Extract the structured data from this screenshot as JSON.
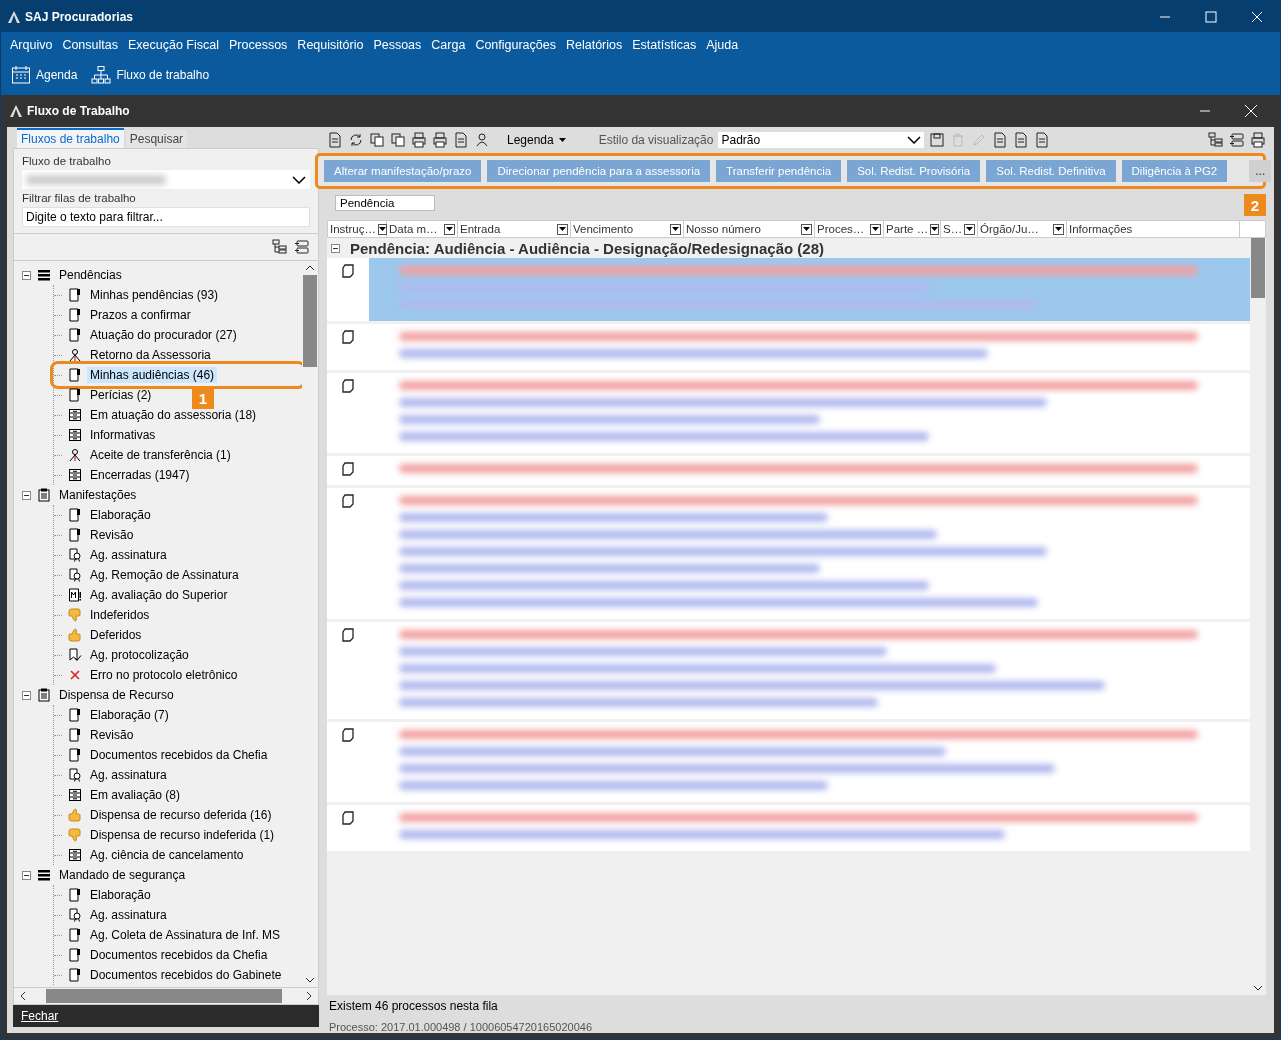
{
  "window": {
    "title": "SAJ Procuradorias"
  },
  "menu": [
    "Arquivo",
    "Consultas",
    "Execução Fiscal",
    "Processos",
    "Requisitório",
    "Pessoas",
    "Carga",
    "Configurações",
    "Relatórios",
    "Estatísticas",
    "Ajuda"
  ],
  "toolbar": [
    {
      "label": "Agenda",
      "kind": "calendar"
    },
    {
      "label": "Fluxo de trabalho",
      "kind": "hierarchy"
    }
  ],
  "inner_window": {
    "title": "Fluxo de Trabalho"
  },
  "left_tabs": [
    {
      "label": "Fluxos de trabalho",
      "selected": true
    },
    {
      "label": "Pesquisar",
      "selected": false
    }
  ],
  "workflow_field": {
    "label": "Fluxo de trabalho"
  },
  "filter_field": {
    "label": "Filtrar filas de trabalho",
    "placeholder": "Digite o texto para filtrar..."
  },
  "tree": [
    {
      "label": "Pendências",
      "kind": "list",
      "expanded": true,
      "children": [
        {
          "label": "Minhas pendências (93)",
          "kind": "doc",
          "selected": false
        },
        {
          "label": "Prazos a confirmar",
          "kind": "doc",
          "selected": false
        },
        {
          "label": "Atuação do procurador (27)",
          "kind": "doc",
          "selected": false
        },
        {
          "label": "Retorno da Assessoria",
          "kind": "person",
          "selected": false
        },
        {
          "label": "Minhas audiências (46)",
          "kind": "doc",
          "selected": true,
          "callout": "1"
        },
        {
          "label": "Perícias (2)",
          "kind": "doc",
          "selected": false
        },
        {
          "label": "Em atuação do assessoria (18)",
          "kind": "cabinet",
          "selected": false
        },
        {
          "label": "Informativas",
          "kind": "cabinet",
          "selected": false
        },
        {
          "label": "Aceite de transferência (1)",
          "kind": "person",
          "selected": false
        },
        {
          "label": "Encerradas (1947)",
          "kind": "cabinet",
          "selected": false
        }
      ]
    },
    {
      "label": "Manifestações",
      "kind": "clipboard",
      "expanded": true,
      "children": [
        {
          "label": "Elaboração",
          "kind": "doc",
          "selected": false
        },
        {
          "label": "Revisão",
          "kind": "doc",
          "selected": false
        },
        {
          "label": "Ag. assinatura",
          "kind": "seal",
          "selected": false
        },
        {
          "label": "Ag. Remoção de Assinatura",
          "kind": "seal",
          "selected": false
        },
        {
          "label": "Ag. avaliação do Superior",
          "kind": "docm",
          "selected": false
        },
        {
          "label": "Indeferidos",
          "kind": "thumbdown",
          "selected": false
        },
        {
          "label": "Deferidos",
          "kind": "thumbup",
          "selected": false
        },
        {
          "label": "Ag. protocolização",
          "kind": "bookmark",
          "selected": false
        },
        {
          "label": "Erro no protocolo eletrônico",
          "kind": "cross",
          "selected": false
        }
      ]
    },
    {
      "label": "Dispensa de Recurso",
      "kind": "clipboard",
      "expanded": true,
      "children": [
        {
          "label": "Elaboração (7)",
          "kind": "doc",
          "selected": false
        },
        {
          "label": "Revisão",
          "kind": "doc",
          "selected": false
        },
        {
          "label": "Documentos recebidos da Chefia",
          "kind": "doc",
          "selected": false
        },
        {
          "label": "Ag. assinatura",
          "kind": "seal",
          "selected": false
        },
        {
          "label": "Em avaliação (8)",
          "kind": "cabinet",
          "selected": false
        },
        {
          "label": "Dispensa de recurso deferida (16)",
          "kind": "thumbup",
          "selected": false
        },
        {
          "label": "Dispensa de recurso indeferida (1)",
          "kind": "thumbdown",
          "selected": false
        },
        {
          "label": "Ag. ciência de cancelamento",
          "kind": "cabinet",
          "selected": false
        }
      ]
    },
    {
      "label": "Mandado de segurança",
      "kind": "list",
      "expanded": true,
      "children": [
        {
          "label": "Elaboração",
          "kind": "doc",
          "selected": false
        },
        {
          "label": "Ag. assinatura",
          "kind": "seal",
          "selected": false
        },
        {
          "label": "Ag. Coleta de Assinatura de Inf. MS",
          "kind": "doc",
          "selected": false
        },
        {
          "label": "Documentos recebidos da Chefia",
          "kind": "doc",
          "selected": false
        },
        {
          "label": "Documentos recebidos do Gabinete",
          "kind": "doc",
          "selected": false
        }
      ]
    }
  ],
  "close_button": "Fechar",
  "view_toolbar": {
    "legend": "Legenda",
    "style_label": "Estilo da visualização",
    "style_value": "Padrão"
  },
  "action_bar": {
    "callout": "2",
    "buttons": [
      "Alterar manifestação/prazo",
      "Direcionar pendência para a assessoria",
      "Transferir pendência",
      "Sol. Redist. Provisória",
      "Sol. Redist. Definitiva",
      "Diligência à PG2"
    ],
    "more": "..."
  },
  "group_by": "Pendência",
  "columns": [
    "Instruç…",
    "Data m…",
    "Entrada",
    "Vencimento",
    "Nosso número",
    "Proces…",
    "Parte …",
    "S…",
    "Órgão/Ju…",
    "Informações"
  ],
  "group_header": {
    "label": "Pendência: Audiência - Audiência - Designação/Redesignação  (28)",
    "expanded": true
  },
  "rows": [
    {
      "selected": true
    },
    {
      "selected": false
    },
    {
      "selected": false
    },
    {
      "selected": false
    },
    {
      "selected": false
    },
    {
      "selected": false
    },
    {
      "selected": false
    },
    {
      "selected": false
    }
  ],
  "status": {
    "count": "Existem 46 processos nesta fila",
    "process": "Processo: 2017.01.000498 / 10006054720165020046"
  }
}
